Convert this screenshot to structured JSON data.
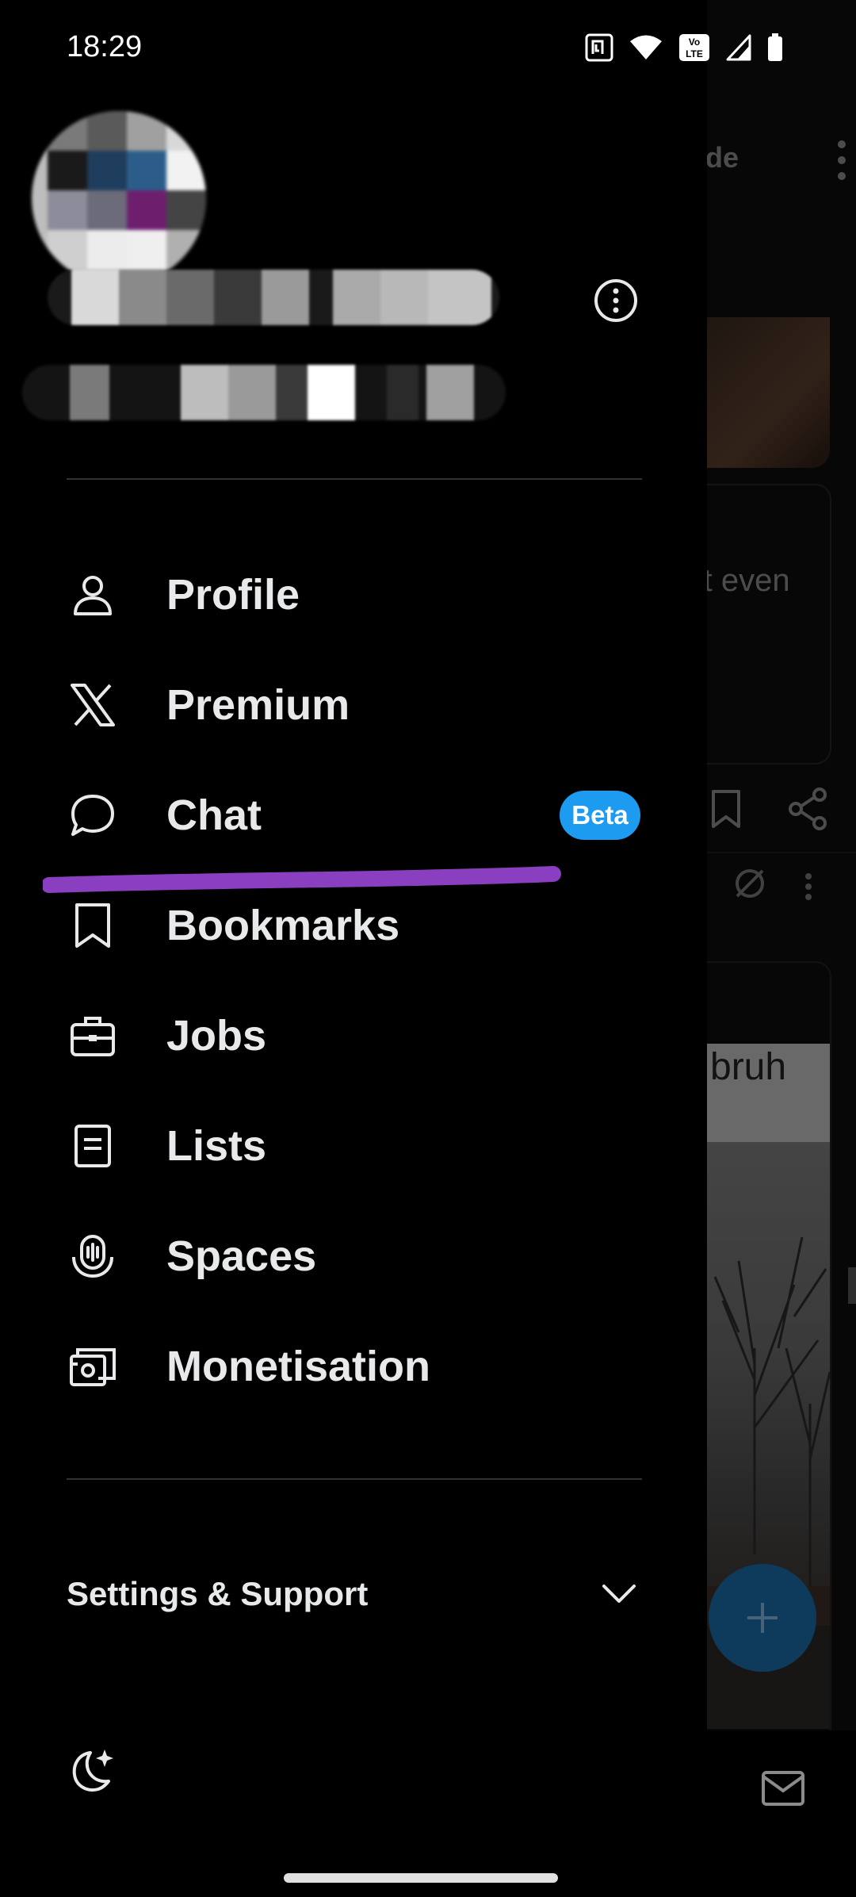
{
  "status_bar": {
    "time": "18:29",
    "icons": [
      "nfc-icon",
      "wifi-icon",
      "volte-icon",
      "signal-icon",
      "battery-icon"
    ],
    "volte_label": "Vo LTE"
  },
  "drawer": {
    "more_options_icon": "more-circle-icon",
    "menu": [
      {
        "key": "profile",
        "label": "Profile",
        "icon": "person-icon"
      },
      {
        "key": "premium",
        "label": "Premium",
        "icon": "x-logo-icon"
      },
      {
        "key": "chat",
        "label": "Chat",
        "icon": "chat-bubble-icon",
        "badge": "Beta"
      },
      {
        "key": "bookmarks",
        "label": "Bookmarks",
        "icon": "bookmark-icon"
      },
      {
        "key": "jobs",
        "label": "Jobs",
        "icon": "briefcase-icon"
      },
      {
        "key": "lists",
        "label": "Lists",
        "icon": "list-icon"
      },
      {
        "key": "spaces",
        "label": "Spaces",
        "icon": "microphone-icon"
      },
      {
        "key": "monetisation",
        "label": "Monetisation",
        "icon": "money-icon"
      }
    ],
    "settings_label": "Settings & Support",
    "settings_chevron_icon": "chevron-down-icon",
    "display_icon": "moon-sparkle-icon"
  },
  "background_timeline": {
    "tab_fragment": "ade",
    "post_fragment": "'t even",
    "meme_fragment": "bruh",
    "compose_icon": "plus-icon",
    "messages_icon": "mail-icon"
  },
  "colors": {
    "background": "#000000",
    "text": "#e7e9ea",
    "divider": "#2f3336",
    "accent": "#1d9bf0",
    "annotation": "#8a3fc0"
  }
}
